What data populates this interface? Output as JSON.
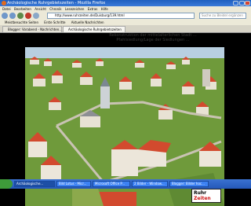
{
  "window": {
    "title": "Archäologische Ruhrgebietszeiten - Mozilla Firefox"
  },
  "menu": [
    "Datei",
    "Bearbeiten",
    "Ansicht",
    "Chronik",
    "Lesezeichen",
    "Extras",
    "Hilfe"
  ],
  "navigation": {
    "url": "http://www.ruhrzeiten.de/Duisburg/139.html",
    "search_placeholder": "Suche zu Bleidel ergänzen"
  },
  "bookmarks": [
    "Meistbesuchte Seiten",
    "Erste Schritte",
    "Aktuelle Nachrichten"
  ],
  "tabs": [
    "Blogger: Vorabend - Nachrichten...",
    "Archäologische Ruhrgebietszeiten"
  ],
  "page": {
    "banner_line1": "Rekonstruktion der mittelalterlichen Stadt ...",
    "banner_line2": "Pfahlsiedlung/Lage der Siedlungen ...",
    "logo_line1": "Ruhr",
    "logo_line2": "Zeiten"
  },
  "taskbar": [
    "Archäologische...",
    "Bild Lotus - Micr...",
    "Microsoft Office P...",
    "2 Bilder - Window...",
    "Blogger: Bilder hoc..."
  ],
  "colors": {
    "grass": "#6f9a3b",
    "roof": "#d24a2e",
    "wall": "#e8e2d4",
    "titlebar": "#1f5fbf"
  }
}
